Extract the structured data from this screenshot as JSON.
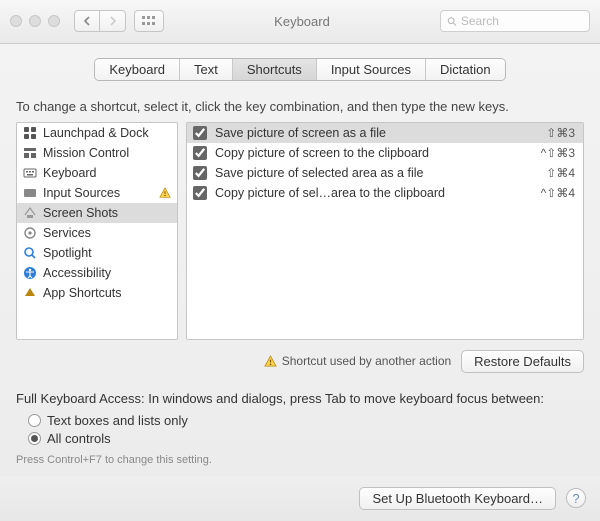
{
  "header": {
    "title": "Keyboard",
    "search_placeholder": "Search"
  },
  "tabs": [
    {
      "label": "Keyboard",
      "active": false
    },
    {
      "label": "Text",
      "active": false
    },
    {
      "label": "Shortcuts",
      "active": true
    },
    {
      "label": "Input Sources",
      "active": false
    },
    {
      "label": "Dictation",
      "active": false
    }
  ],
  "instruction": "To change a shortcut, select it, click the key combination, and then type the new keys.",
  "categories": [
    {
      "label": "Launchpad & Dock",
      "icon": "launchpad-icon",
      "selected": false,
      "warning": false
    },
    {
      "label": "Mission Control",
      "icon": "mission-icon",
      "selected": false,
      "warning": false
    },
    {
      "label": "Keyboard",
      "icon": "keyboard-icon",
      "selected": false,
      "warning": false
    },
    {
      "label": "Input Sources",
      "icon": "input-icon",
      "selected": false,
      "warning": true
    },
    {
      "label": "Screen Shots",
      "icon": "screenshot-icon",
      "selected": true,
      "warning": false
    },
    {
      "label": "Services",
      "icon": "services-icon",
      "selected": false,
      "warning": false
    },
    {
      "label": "Spotlight",
      "icon": "spotlight-icon",
      "selected": false,
      "warning": false
    },
    {
      "label": "Accessibility",
      "icon": "accessibility-icon",
      "selected": false,
      "warning": false
    },
    {
      "label": "App Shortcuts",
      "icon": "appshortcut-icon",
      "selected": false,
      "warning": false
    }
  ],
  "shortcuts": [
    {
      "checked": true,
      "desc": "Save picture of screen as a file",
      "combo": "⇧⌘3",
      "selected": true
    },
    {
      "checked": true,
      "desc": "Copy picture of screen to the clipboard",
      "combo": "^⇧⌘3",
      "selected": false
    },
    {
      "checked": true,
      "desc": "Save picture of selected area as a file",
      "combo": "⇧⌘4",
      "selected": false
    },
    {
      "checked": true,
      "desc": "Copy picture of sel…area to the clipboard",
      "combo": "^⇧⌘4",
      "selected": false
    }
  ],
  "warning_note": "Shortcut used by another action",
  "restore_label": "Restore Defaults",
  "fka_intro": "Full Keyboard Access: In windows and dialogs, press Tab to move keyboard focus between:",
  "fka_options": [
    {
      "label": "Text boxes and lists only",
      "selected": false
    },
    {
      "label": "All controls",
      "selected": true
    }
  ],
  "fka_hint": "Press Control+F7 to change this setting.",
  "footer": {
    "bluetooth_label": "Set Up Bluetooth Keyboard…"
  }
}
